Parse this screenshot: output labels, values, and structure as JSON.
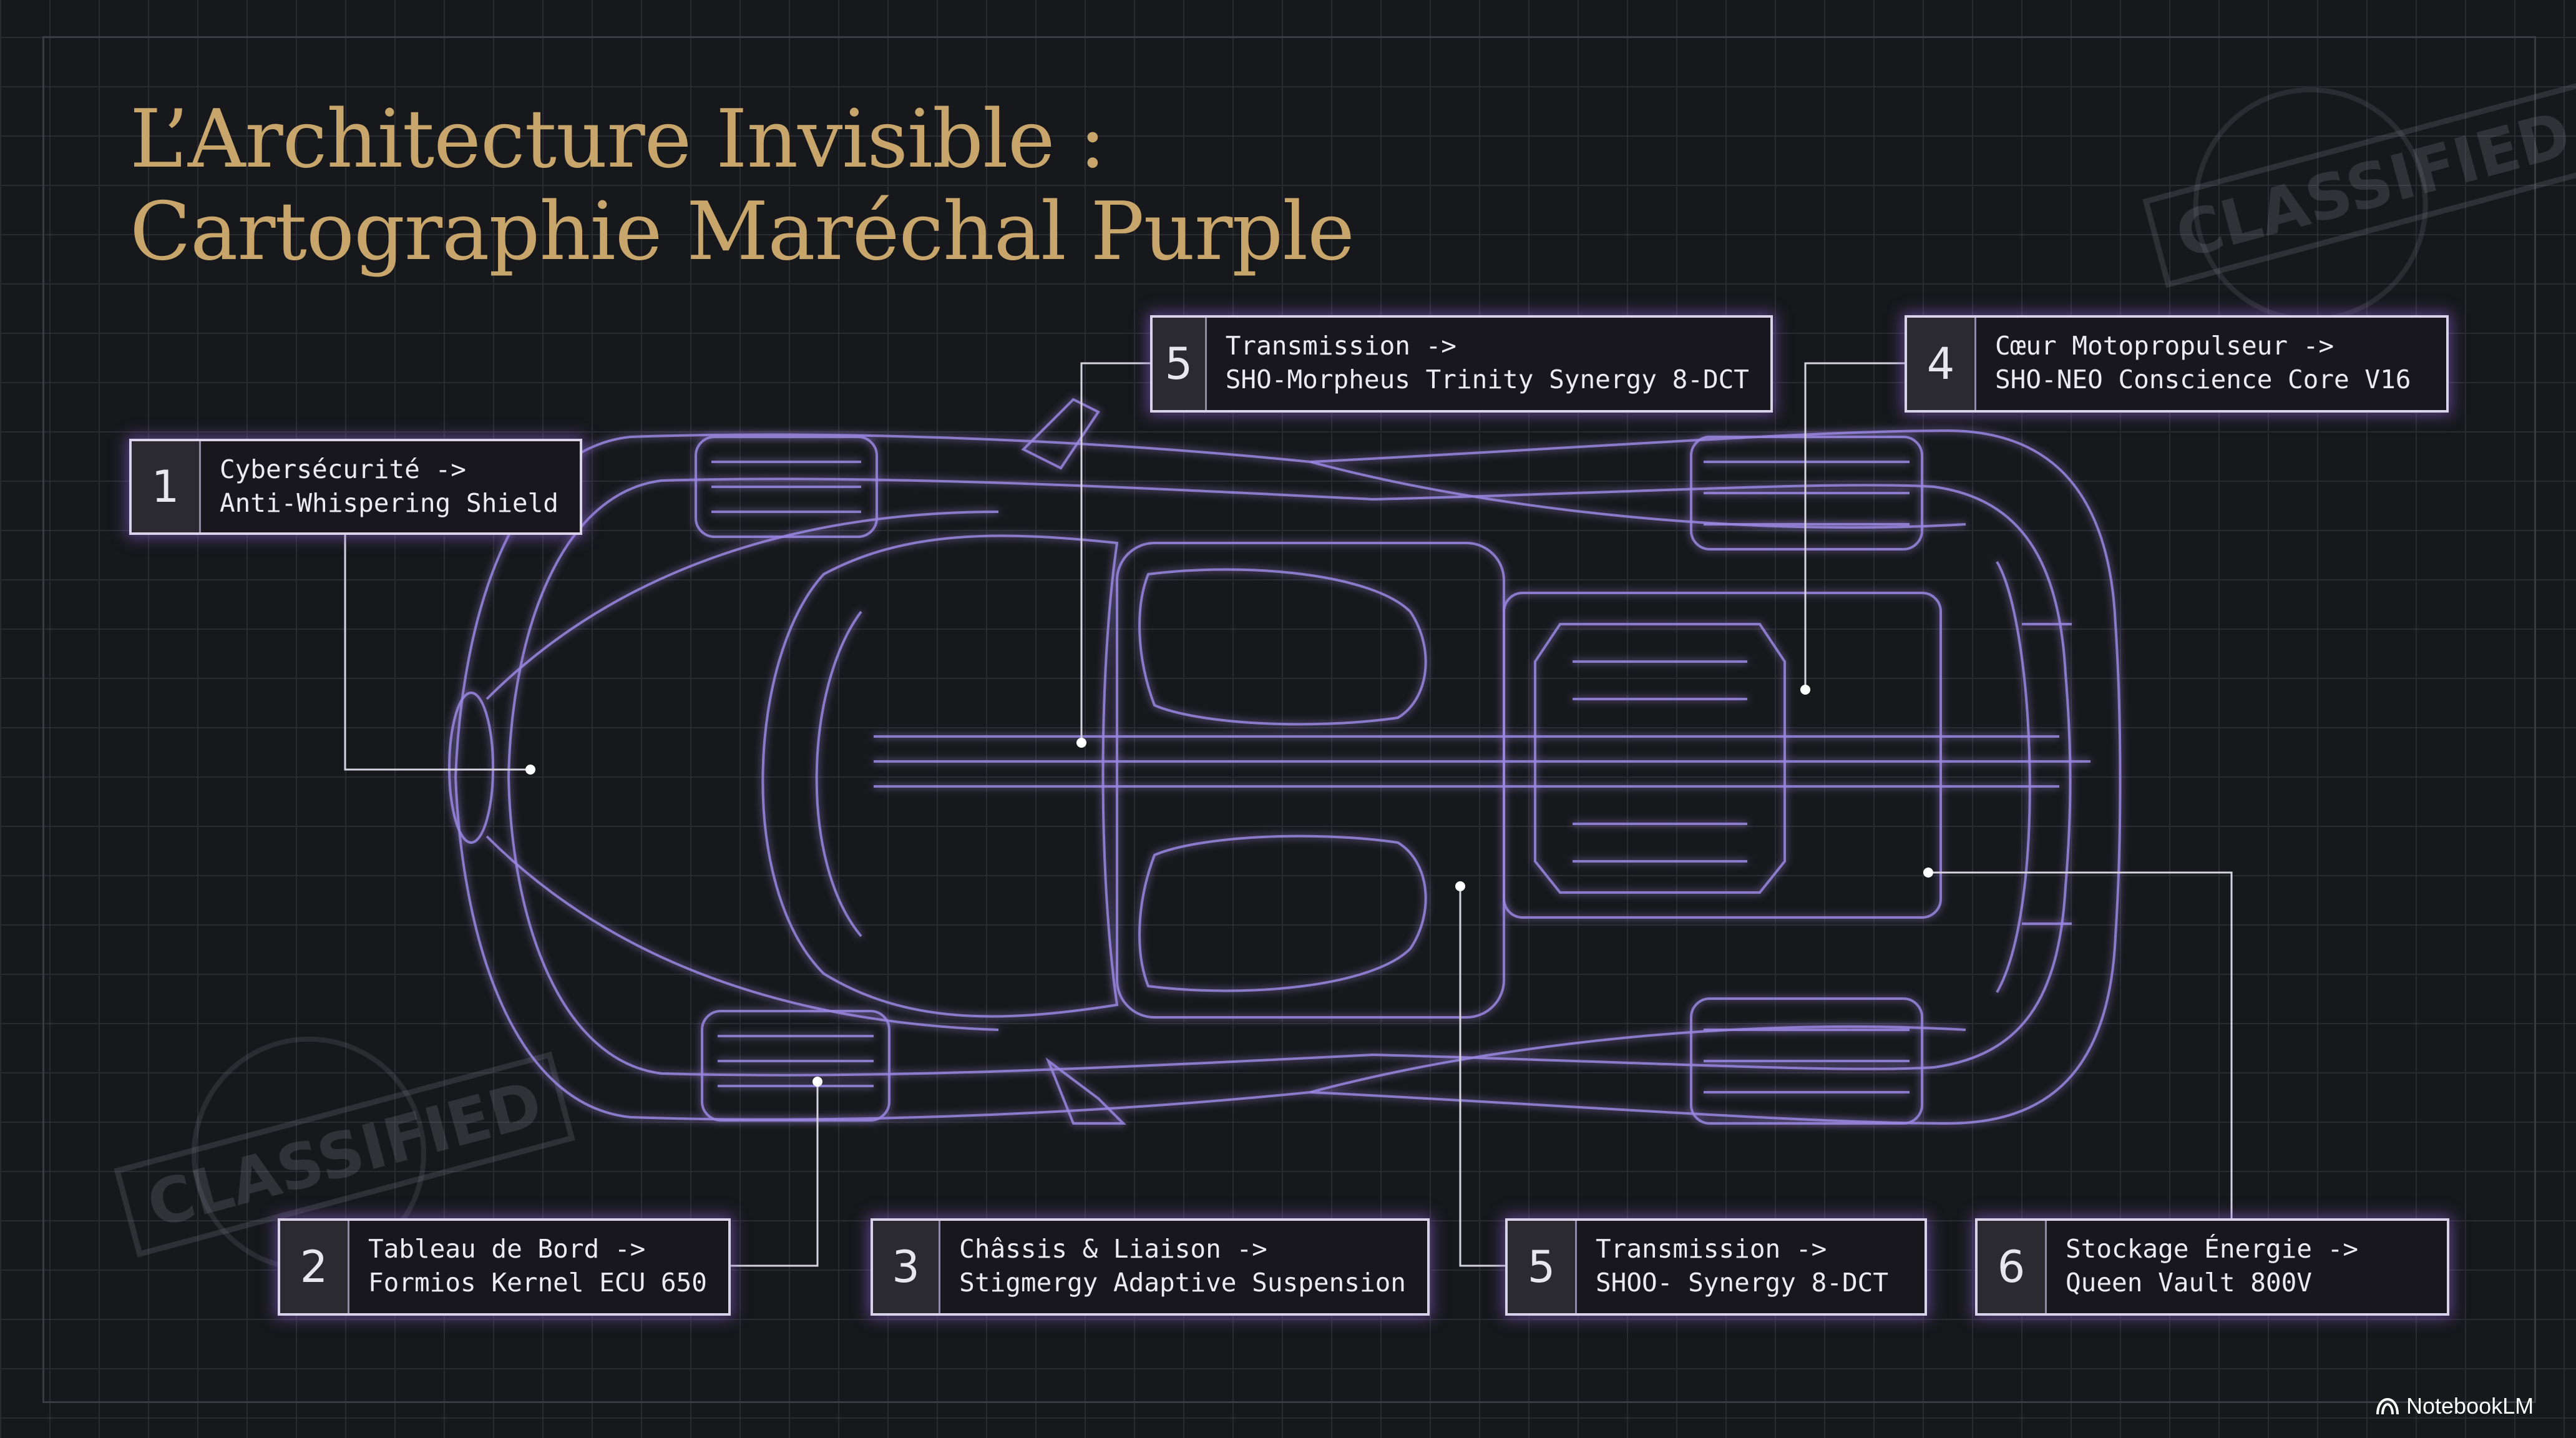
{
  "title": {
    "line1": "L’Architecture Invisible :",
    "line2": "Cartographie Maréchal Purple"
  },
  "callouts": [
    {
      "num": "1",
      "line1": "Cybersécurité ->",
      "line2": "Anti-Whispering Shield"
    },
    {
      "num": "5",
      "line1": "Transmission ->",
      "line2": "SHO-Morpheus Trinity Synergy 8-DCT"
    },
    {
      "num": "4",
      "line1": "Cœur Motopropulseur ->",
      "line2": "SHO-NEO Conscience Core V16"
    },
    {
      "num": "2",
      "line1": "Tableau de Bord ->",
      "line2": "Formios Kernel ECU 650"
    },
    {
      "num": "3",
      "line1": "Châssis & Liaison ->",
      "line2": "Stigmergy Adaptive Suspension"
    },
    {
      "num": "5",
      "line1": "Transmission ->",
      "line2": "SHOO- Synergy 8-DCT"
    },
    {
      "num": "6",
      "line1": "Stockage Énergie ->",
      "line2": "Queen Vault 800V"
    }
  ],
  "stamps": {
    "main_text": "CLASSIFIED",
    "ring_text": "CLASSIFIED"
  },
  "branding": {
    "logo_text": "NotebookLM",
    "logo_icon": "notebooklm-logo-icon"
  },
  "colors": {
    "background": "#17181c",
    "title": "#c8a66b",
    "blueprint_line": "#9a86e0",
    "callout_border": "#d9d3ea"
  }
}
